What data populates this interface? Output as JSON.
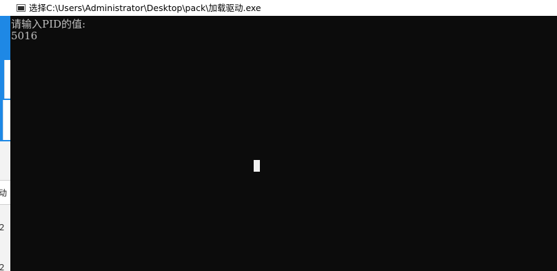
{
  "window": {
    "title": "选择C:\\Users\\Administrator\\Desktop\\pack\\加载驱动.exe",
    "icon": "console-window-icon"
  },
  "console": {
    "lines": [
      "请输入PID的值:",
      "5016"
    ],
    "text_color": "#c0c0c0",
    "background_color": "#0c0c0c",
    "cursor": "block-cursor"
  },
  "background_window": {
    "tab_text": "动",
    "digits": [
      "2",
      "2"
    ],
    "accent_color": "#1e88e5"
  }
}
